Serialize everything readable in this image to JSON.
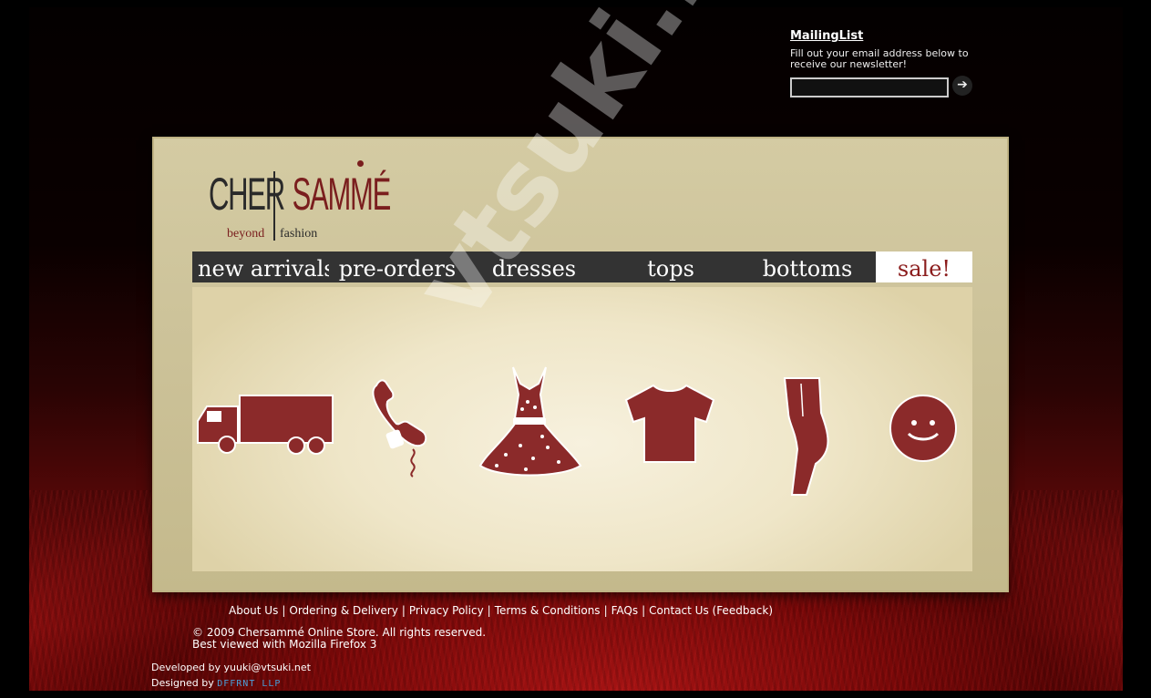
{
  "mailing": {
    "title": "MailingList",
    "description": "Fill out your email address below to receive our newsletter!",
    "input_value": "",
    "submit_icon": "arrow-right-icon"
  },
  "logo": {
    "cher": "CHER",
    "samme": "SAMMÉ",
    "beyond": "beyond",
    "fashion": "fashion"
  },
  "nav": {
    "items": [
      {
        "label": "new arrivals"
      },
      {
        "label": "pre-orders"
      },
      {
        "label": "dresses"
      },
      {
        "label": "tops"
      },
      {
        "label": "bottoms"
      },
      {
        "label": "sale!"
      }
    ]
  },
  "icons": [
    "truck-icon",
    "phone-icon",
    "dress-icon",
    "tshirt-icon",
    "pants-icon",
    "smiley-icon"
  ],
  "colors": {
    "accent": "#8b2a2a",
    "nav_bg": "#333333",
    "sale_text": "#8b1c1c"
  },
  "watermark": "vtsuki.net",
  "footer": {
    "links": [
      "About Us",
      "Ordering & Delivery",
      "Privacy Policy",
      "Terms & Conditions",
      "FAQs",
      "Contact Us (Feedback)"
    ],
    "copyright": "© 2009 Chersammé Online Store. All rights reserved.",
    "best_viewed": "Best viewed with Mozilla Firefox 3",
    "developed": "Developed by yuuki@vtsuki.net",
    "designed_prefix": "Designed by",
    "designed_brand": "DFFRNT LLP"
  }
}
